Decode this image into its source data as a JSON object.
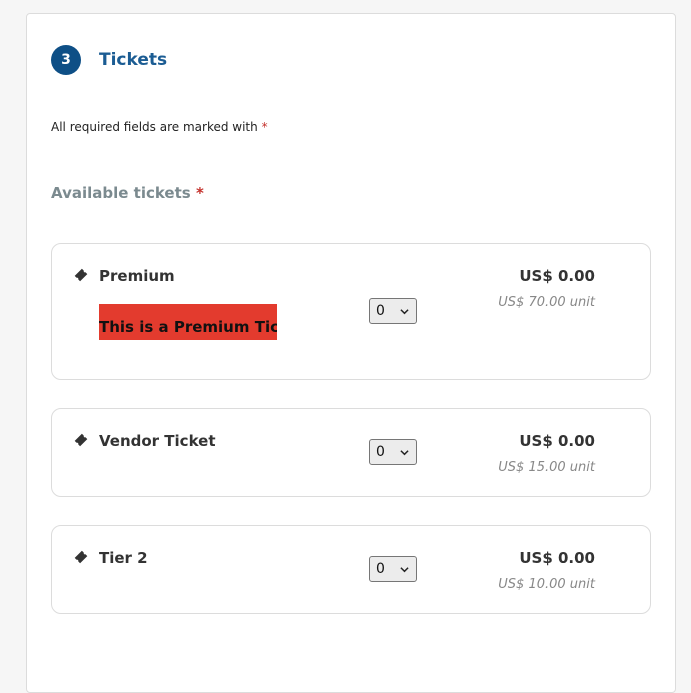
{
  "section": {
    "step_number": "3",
    "title": "Tickets",
    "required_note": "All required fields are marked with",
    "required_star": "*",
    "available_label": "Available tickets",
    "available_star": "*"
  },
  "tickets": [
    {
      "name": "Premium",
      "description": "This is a Premium Ticket",
      "quantity": "0",
      "total": "US$ 0.00",
      "unit_price": "US$ 70.00 unit"
    },
    {
      "name": "Vendor Ticket",
      "quantity": "0",
      "total": "US$ 0.00",
      "unit_price": "US$ 15.00 unit"
    },
    {
      "name": "Tier 2",
      "quantity": "0",
      "total": "US$ 0.00",
      "unit_price": "US$ 10.00 unit"
    }
  ],
  "icons": {
    "ticket": "ticket-icon",
    "select_arrow": "chevron-down-icon"
  },
  "colors": {
    "step_badge": "#0e4f86",
    "title": "#1b5c93",
    "required": "#c4302b",
    "description_highlight": "#e33b2e"
  }
}
